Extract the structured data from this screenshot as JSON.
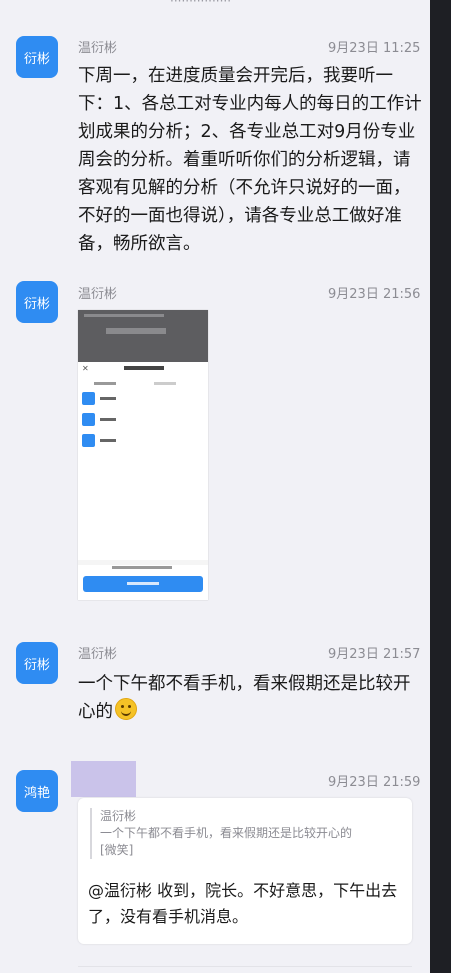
{
  "top_hint": "················",
  "messages": [
    {
      "avatar": "衍彬",
      "sender": "温衍彬",
      "time": "9月23日 11:25",
      "text": "下周一，在进度质量会开完后，我要听一下：1、各总工对专业内每人的每日的工作计划成果的分析；2、各专业总工对9月份专业周会的分析。着重听听你们的分析逻辑，请客观有见解的分析（不允许只说好的一面，不好的一面也得说），请各专业总工做好准备，畅所欲言。"
    },
    {
      "avatar": "衍彬",
      "sender": "温衍彬",
      "time": "9月23日 21:56",
      "type": "image",
      "image_desc_icon": "screenshot-thumbnail"
    },
    {
      "avatar": "衍彬",
      "sender": "温衍彬",
      "time": "9月23日 21:57",
      "text": "一个下午都不看手机，看来假期还是比较开心的",
      "emoji": "smile-emoji"
    },
    {
      "avatar": "鸿艳",
      "time": "9月23日 21:59",
      "quote_sender": "温衍彬",
      "quote_text": "一个下午都不看手机，看来假期还是比较开心的",
      "quote_emoji": "[微笑]",
      "reply": "@温衍彬 收到，院长。不好意思，下午出去了，没有看手机消息。"
    }
  ],
  "colors": {
    "accent": "#2f8cf2",
    "bg": "#f1f1f6",
    "redact": "#cac3ea"
  }
}
